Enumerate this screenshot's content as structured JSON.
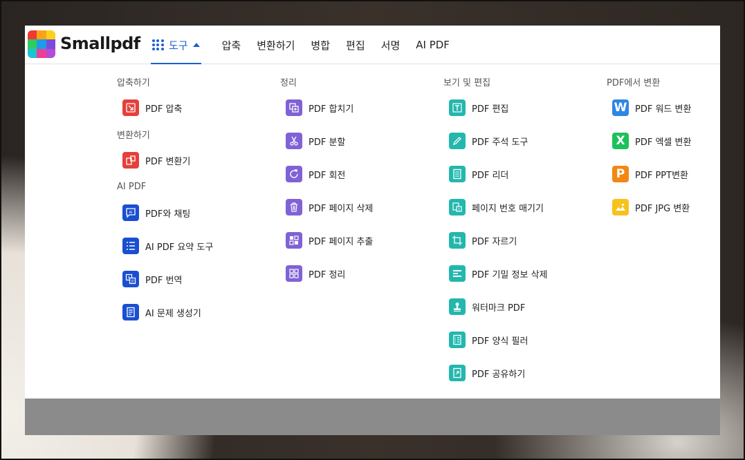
{
  "brand": {
    "name": "Smallpdf",
    "logo_colors": [
      "#f0392f",
      "#f8a31a",
      "#fbd11b",
      "#2ecc62",
      "#1e9be8",
      "#7b4bd9",
      "#1cc4d3",
      "#ee3e94",
      "#b24bd8"
    ]
  },
  "nav": {
    "tools_label": "도구",
    "items": [
      "압축",
      "변환하기",
      "병합",
      "편집",
      "서명",
      "AI PDF"
    ]
  },
  "menu": {
    "col1": {
      "sections": [
        {
          "title": "압축하기",
          "items": [
            "PDF 압축"
          ]
        },
        {
          "title": "변환하기",
          "items": [
            "PDF 변환기"
          ]
        },
        {
          "title": "AI PDF",
          "items": [
            "PDF와 채팅",
            "AI PDF 요약 도구",
            "PDF 번역",
            "AI 문제 생성기"
          ]
        }
      ]
    },
    "col2": {
      "title": "정리",
      "items": [
        "PDF 합치기",
        "PDF 분할",
        "PDF 회전",
        "PDF 페이지 삭제",
        "PDF 페이지 추출",
        "PDF 정리"
      ]
    },
    "col3": {
      "title": "보기 및 편집",
      "items": [
        "PDF 편집",
        "PDF 주석 도구",
        "PDF 리더",
        "페이지 번호 매기기",
        "PDF 자르기",
        "PDF 기밀 정보 삭제",
        "워터마크 PDF",
        "PDF 양식 필러",
        "PDF 공유하기"
      ]
    },
    "col4": {
      "title": "PDF에서 변환",
      "items": [
        "PDF 워드 변환",
        "PDF 엑셀 변환",
        "PDF PPT변환",
        "PDF JPG 변환"
      ],
      "icon_letters": [
        "W",
        "X",
        "P"
      ]
    }
  },
  "colors": {
    "accent": "#1b5fd1",
    "compress": "#e5403b",
    "ai": "#1b4fd1",
    "organize": "#8062d6",
    "edit": "#23b7ad"
  }
}
